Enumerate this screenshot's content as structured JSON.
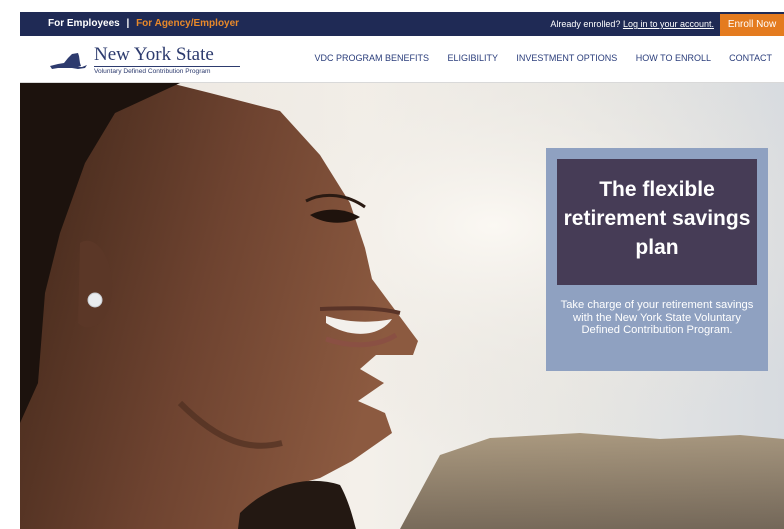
{
  "topbar": {
    "for_employees": "For Employees",
    "separator": "|",
    "for_agency": "For Agency/Employer",
    "already_enrolled": "Already enrolled?",
    "login_link": "Log in to your account.",
    "enroll_button": "Enroll Now",
    "colors": {
      "bar": "#1f2a55",
      "accent": "#e47b1f"
    }
  },
  "logo": {
    "title": "New York State",
    "subtitle": "Voluntary Defined Contribution Program",
    "icon": "new-york-state-map-icon"
  },
  "nav": {
    "items": [
      "VDC PROGRAM BENEFITS",
      "ELIGIBILITY",
      "INVESTMENT OPTIONS",
      "HOW TO ENROLL",
      "CONTACT"
    ]
  },
  "hero": {
    "headline": "The flexible retirement savings plan",
    "body": "Take charge of your retirement savings with the New York State Voluntary Defined Contribution Program.",
    "colors": {
      "panel": "#8fa1c1",
      "headline_box": "#463c56"
    }
  }
}
